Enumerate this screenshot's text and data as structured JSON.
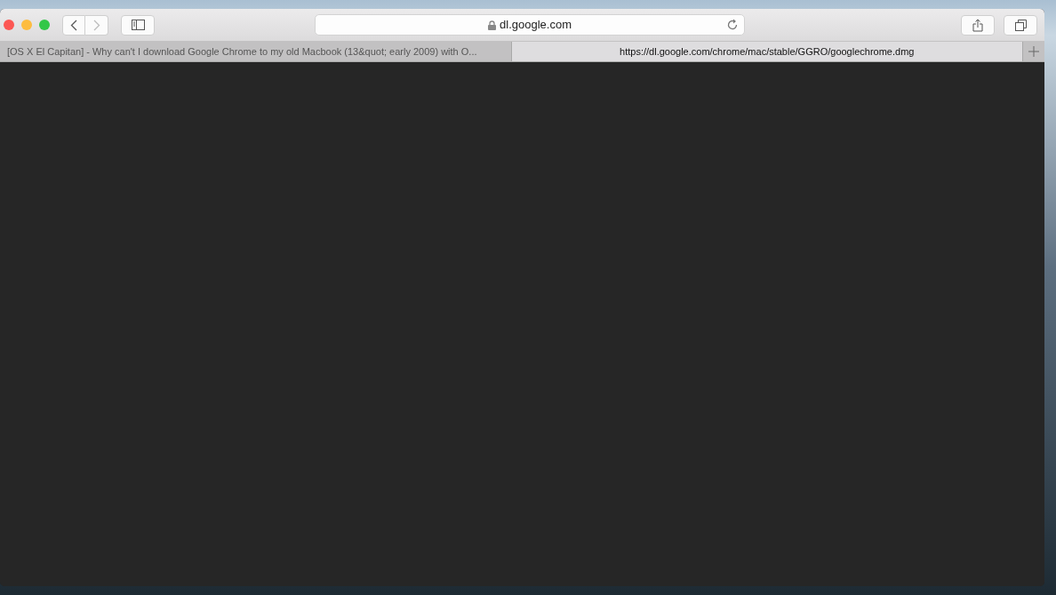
{
  "toolbar": {
    "address": "dl.google.com"
  },
  "tabs": [
    {
      "label": "[OS X El Capitan] - Why can't I download Google Chrome to my old Macbook (13&quot; early 2009) with O...",
      "selected": false
    },
    {
      "label": "https://dl.google.com/chrome/mac/stable/GGRO/googlechrome.dmg",
      "selected": true
    }
  ]
}
